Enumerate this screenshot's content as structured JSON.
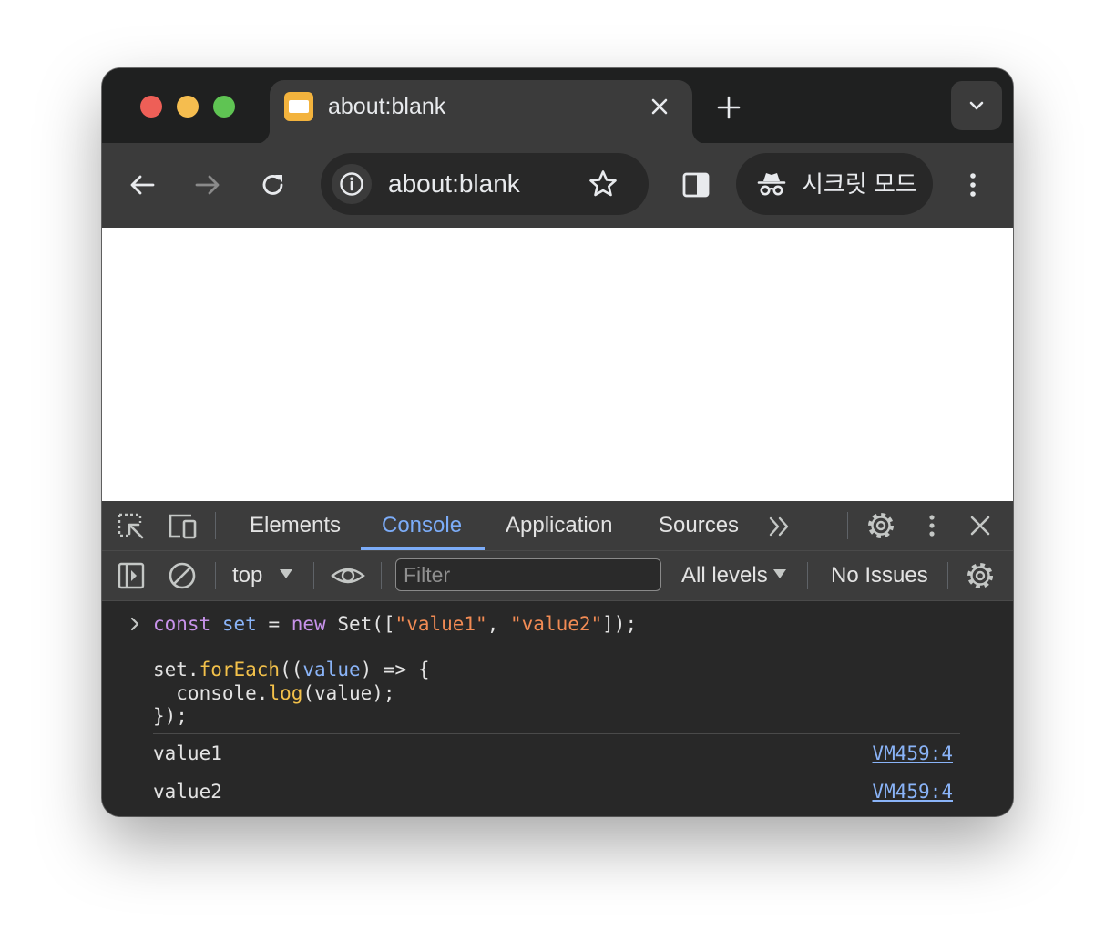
{
  "tab": {
    "title": "about:blank"
  },
  "omnibox": {
    "url": "about:blank"
  },
  "incognito": {
    "label": "시크릿 모드"
  },
  "devtools": {
    "tabs": [
      "Elements",
      "Console",
      "Application",
      "Sources"
    ],
    "active_tab": "Console",
    "context": "top",
    "filter_placeholder": "Filter",
    "levels": "All levels",
    "issues": "No Issues"
  },
  "console": {
    "input": {
      "line1": [
        {
          "t": "const",
          "c": "kw"
        },
        {
          "t": " "
        },
        {
          "t": "set",
          "c": "var"
        },
        {
          "t": " = "
        },
        {
          "t": "new",
          "c": "kw"
        },
        {
          "t": " Set(["
        },
        {
          "t": "\"value1\"",
          "c": "str"
        },
        {
          "t": ", "
        },
        {
          "t": "\"value2\"",
          "c": "str"
        },
        {
          "t": "]);"
        }
      ],
      "line2": [
        {
          "t": "set."
        },
        {
          "t": "forEach",
          "c": "fn"
        },
        {
          "t": "(("
        },
        {
          "t": "value",
          "c": "var"
        },
        {
          "t": ") => {"
        }
      ],
      "line3": [
        {
          "t": "  console."
        },
        {
          "t": "log",
          "c": "fn"
        },
        {
          "t": "(value);"
        }
      ],
      "line4": [
        {
          "t": "});"
        }
      ]
    },
    "logs": [
      {
        "text": "value1",
        "source": "VM459:4"
      },
      {
        "text": "value2",
        "source": "VM459:4"
      }
    ]
  }
}
